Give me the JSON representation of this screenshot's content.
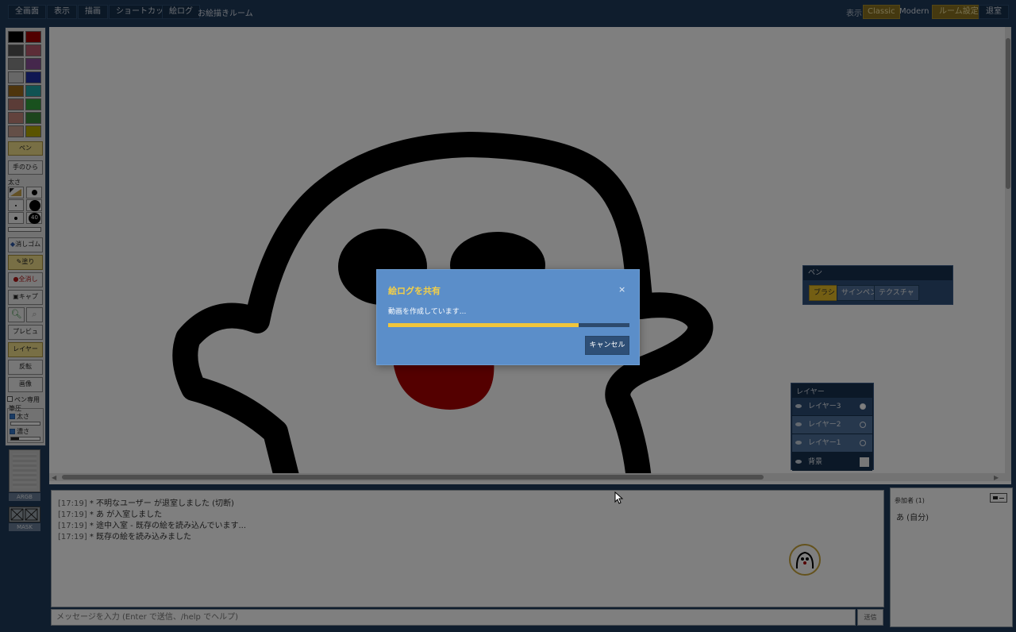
{
  "toolbar": {
    "fullscreen": "全画面",
    "view": "表示",
    "draw": "描画",
    "shortcut": "ショートカット",
    "log": "絵ログ",
    "room_name": "お絵描きルーム",
    "display_label": "表示:",
    "classic": "Classic",
    "modern": "Modern",
    "room_settings": "ルーム設定",
    "leave": "退室"
  },
  "palette": [
    "#000000",
    "#a30000",
    "#555555",
    "#b85a6e",
    "#888888",
    "#8b4f98",
    "#cfcfcf",
    "#1f2fa4",
    "#9d6b1a",
    "#21a6a6",
    "#b7796e",
    "#33a23c",
    "#c4847a",
    "#3b8b3b",
    "#c99f8f",
    "#b5a800"
  ],
  "tools": {
    "pen": "ペン",
    "hand": "手のひら",
    "size_label": "太さ",
    "size_number": "40",
    "eraser": "消しゴム",
    "autofill": "塗り",
    "fill": "全消し",
    "capture": "キャプ",
    "preview": "プレビュ",
    "layer": "レイヤー",
    "flip": "反転",
    "image": "画像",
    "pen_only": "ペン専用",
    "pressure": "筆圧",
    "pressure_size": "太さ",
    "pressure_density": "濃さ"
  },
  "pen_panel": {
    "title": "ペン",
    "tabs": [
      "ブラシ",
      "サインペン",
      "テクスチャ"
    ]
  },
  "layers": {
    "title": "レイヤー",
    "items": [
      "レイヤー3",
      "レイヤー2",
      "レイヤー1"
    ],
    "background": "背景"
  },
  "argb_label": "ARGB",
  "mask_label": "MASK",
  "chat": {
    "lines": [
      {
        "time": "[17:19]",
        "text": "* 不明なユーザー が退室しました (切断)"
      },
      {
        "time": "[17:19]",
        "text": "* あ が入室しました"
      },
      {
        "time": "[17:19]",
        "text": "* 途中入室 - 既存の絵を読み込んでいます..."
      },
      {
        "time": "[17:19]",
        "text": "* 既存の絵を読み込みました"
      }
    ],
    "input_placeholder": "メッセージを入力 (Enter で送信、/help でヘルプ)",
    "send": "送信"
  },
  "participants": {
    "title": "参加者 (1)",
    "self": "あ (自分)"
  },
  "dialog": {
    "title": "絵ログを共有",
    "close": "×",
    "message": "動画を作成しています...",
    "progress": 0.79,
    "cancel": "キャンセル"
  },
  "colors": {
    "accent_gold": "#f0c53b",
    "dialog_bg": "#5b8ec9",
    "panel_dark": "#16304e"
  }
}
